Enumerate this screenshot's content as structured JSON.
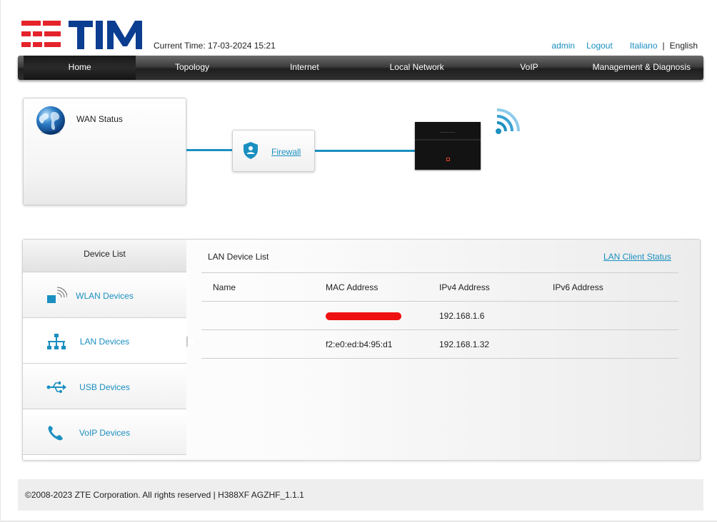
{
  "header": {
    "current_time": "Current Time: 17-03-2024 15:21",
    "user": "admin",
    "logout": "Logout",
    "lang_it": "Italiano",
    "lang_sep": "|",
    "lang_en": "English"
  },
  "nav": [
    "Home",
    "Topology",
    "Internet",
    "Local Network",
    "VoIP",
    "Management & Diagnosis"
  ],
  "topology": {
    "wan_label": "WAN Status",
    "firewall_link": "Firewall"
  },
  "device_list": {
    "title": "Device List",
    "items": [
      "WLAN Devices",
      "LAN Devices",
      "USB Devices",
      "VoIP Devices"
    ]
  },
  "lan_panel": {
    "title": "LAN Device List",
    "client_status_link": "LAN Client Status",
    "columns": [
      "Name",
      "MAC Address",
      "IPv4 Address",
      "IPv6 Address"
    ],
    "rows": [
      [
        "",
        "",
        "192.168.1.6",
        ""
      ],
      [
        "",
        "f2:e0:ed:b4:95:d1",
        "192.168.1.32",
        ""
      ]
    ]
  },
  "footer": {
    "copyright": "©2008-2023 ZTE Corporation. All rights reserved  |   H388XF AGZHF_1.1.1"
  },
  "colors": {
    "accent": "#1a8fc0",
    "brand_red": "#e4232b",
    "brand_blue": "#0b3d91"
  }
}
